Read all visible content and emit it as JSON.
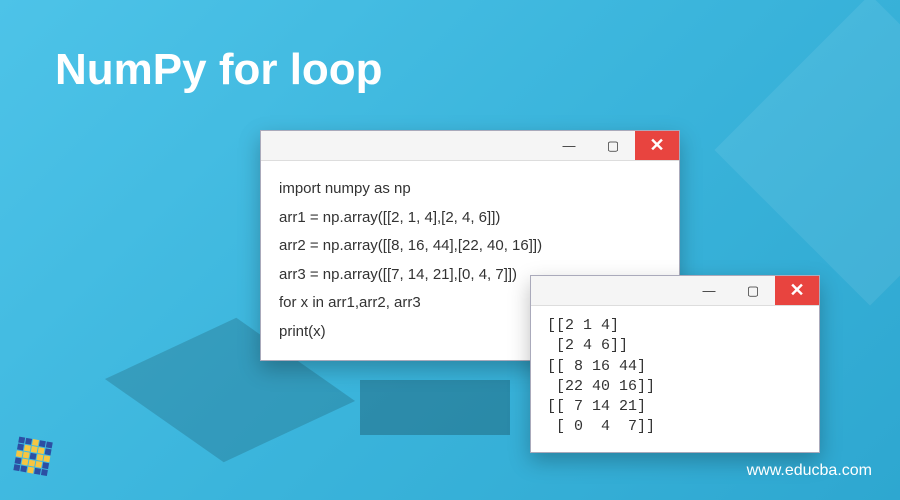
{
  "title": "NumPy for loop",
  "website": "www.educba.com",
  "window_controls": {
    "minimize": "—",
    "maximize": "▢",
    "close": "✕"
  },
  "code": {
    "line1": "import numpy as np",
    "line2": "arr1 = np.array([[2, 1, 4],[2, 4, 6]])",
    "line3": "arr2 = np.array([[8, 16, 44],[22, 40, 16]])",
    "line4": "arr3 = np.array([[7, 14, 21],[0, 4, 7]])",
    "line5": "for x in arr1,arr2, arr3",
    "line6": "print(x)"
  },
  "output": {
    "text": "[[2 1 4]\n [2 4 6]]\n[[ 8 16 44]\n [22 40 16]]\n[[ 7 14 21]\n [ 0  4  7]]"
  },
  "chart_data": {
    "type": "table",
    "title": "NumPy arrays printed via for loop",
    "series": [
      {
        "name": "arr1",
        "values": [
          [
            2,
            1,
            4
          ],
          [
            2,
            4,
            6
          ]
        ]
      },
      {
        "name": "arr2",
        "values": [
          [
            8,
            16,
            44
          ],
          [
            22,
            40,
            16
          ]
        ]
      },
      {
        "name": "arr3",
        "values": [
          [
            7,
            14,
            21
          ],
          [
            0,
            4,
            7
          ]
        ]
      }
    ]
  }
}
